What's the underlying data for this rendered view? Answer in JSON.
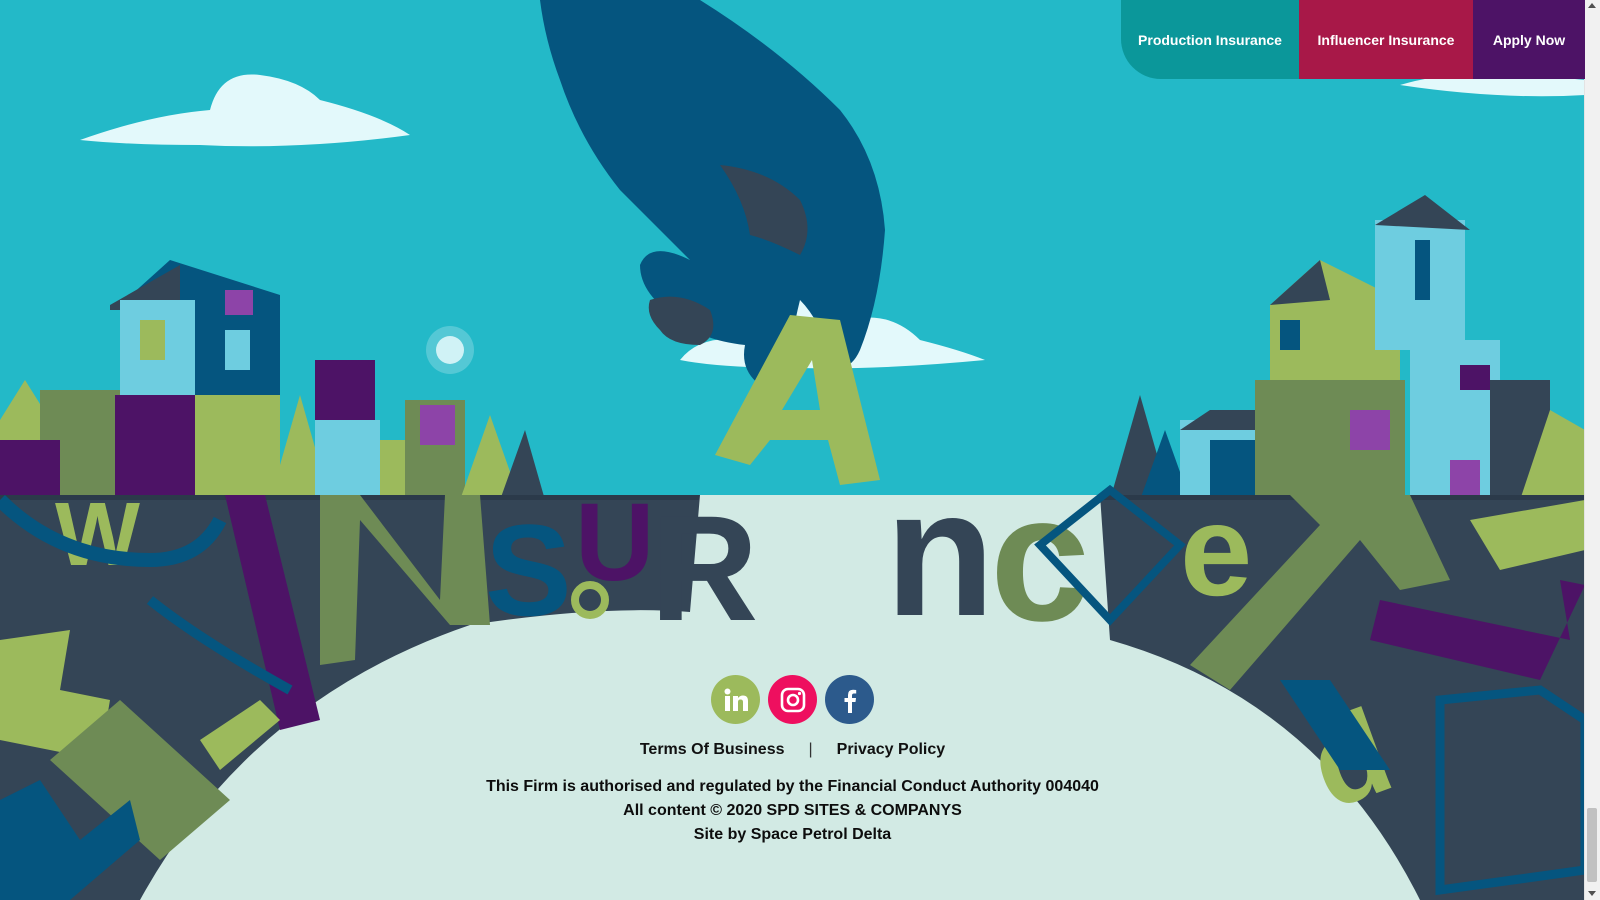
{
  "nav": {
    "production": "Production Insurance",
    "influencer": "Influencer Insurance",
    "apply": "Apply Now"
  },
  "social": [
    {
      "name": "LinkedIn",
      "icon": "linkedin-icon",
      "color": "#9cba5c"
    },
    {
      "name": "Instagram",
      "icon": "instagram-icon",
      "color": "#ee0f5f"
    },
    {
      "name": "Facebook",
      "icon": "facebook-icon",
      "color": "#2c5a8c"
    }
  ],
  "footer": {
    "terms": "Terms Of Business",
    "separator": "|",
    "privacy": "Privacy Policy",
    "regulation": "This Firm is authorised and regulated by the Financial Conduct Authority 004040",
    "copyright": "All content © 2020 SPD SITES & COMPANYS",
    "credit": "Site by Space Petrol Delta"
  },
  "colors": {
    "sky": "#23b9c8",
    "ground": "#d2eae4",
    "production_nav": "#0b979a",
    "influencer_nav": "#a81848",
    "apply_nav": "#4d1366"
  }
}
